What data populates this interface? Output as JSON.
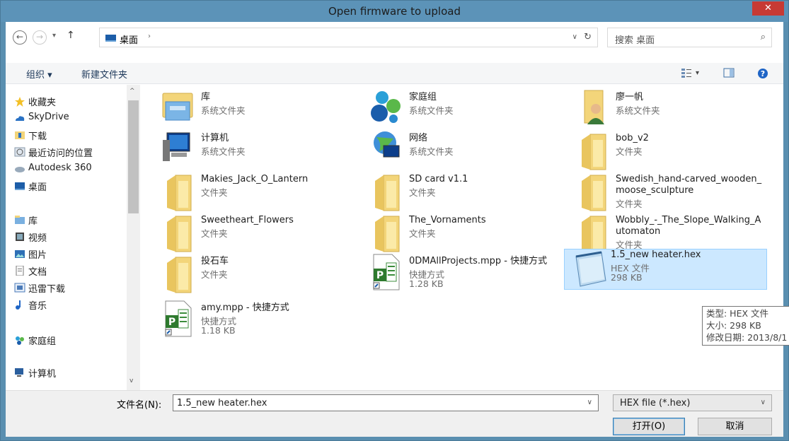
{
  "window": {
    "title": "Open firmware to upload",
    "close_glyph": "✕"
  },
  "nav": {
    "back_glyph": "←",
    "forward_glyph": "→",
    "recent_glyph": "▾",
    "up_glyph": "↑",
    "address_crumb": "桌面",
    "crumb_arrow": "›",
    "address_dropdown": "∨",
    "refresh_glyph": "↻",
    "search_placeholder": "搜索 桌面",
    "search_glyph": "⌕"
  },
  "toolbar": {
    "organize": "组织 ▾",
    "new_folder": "新建文件夹",
    "view_dropdown": "▾",
    "help_glyph": "?"
  },
  "sidebar": {
    "items": [
      {
        "label": "收藏夹",
        "icon": "star-icon",
        "top": 0
      },
      {
        "label": "SkyDrive",
        "icon": "cloud-icon"
      },
      {
        "label": "下载",
        "icon": "download-folder-icon"
      },
      {
        "label": "最近访问的位置",
        "icon": "recent-places-icon"
      },
      {
        "label": "Autodesk 360",
        "icon": "autodesk-icon"
      },
      {
        "label": "桌面",
        "icon": "desktop-icon"
      },
      {
        "label": "库",
        "icon": "library-icon"
      },
      {
        "label": "视频",
        "icon": "video-icon"
      },
      {
        "label": "图片",
        "icon": "picture-icon"
      },
      {
        "label": "文档",
        "icon": "document-icon"
      },
      {
        "label": "迅雷下载",
        "icon": "thunder-icon"
      },
      {
        "label": "音乐",
        "icon": "music-icon"
      },
      {
        "label": "家庭组",
        "icon": "homegroup-icon"
      },
      {
        "label": "计算机",
        "icon": "computer-icon"
      }
    ],
    "scroll_up": "^",
    "scroll_down": "v"
  },
  "files": [
    {
      "name": "库",
      "sub1": "系统文件夹",
      "icon": "library-icon"
    },
    {
      "name": "家庭组",
      "sub1": "系统文件夹",
      "icon": "homegroup-icon"
    },
    {
      "name": "廖一帆",
      "sub1": "系统文件夹",
      "icon": "user-folder-icon"
    },
    {
      "name": "计算机",
      "sub1": "系统文件夹",
      "icon": "computer-icon"
    },
    {
      "name": "网络",
      "sub1": "系统文件夹",
      "icon": "network-icon"
    },
    {
      "name": "bob_v2",
      "sub1": "文件夹",
      "icon": "folder-icon"
    },
    {
      "name": "Makies_Jack_O_Lantern",
      "sub1": "文件夹",
      "icon": "folder-icon"
    },
    {
      "name": "SD card v1.1",
      "sub1": "文件夹",
      "icon": "folder-icon"
    },
    {
      "name": "Swedish_hand-carved_wooden_\nmoose_sculpture",
      "sub1": "文件夹",
      "icon": "folder-icon"
    },
    {
      "name": "Sweetheart_Flowers",
      "sub1": "文件夹",
      "icon": "folder-icon"
    },
    {
      "name": "The_Vornaments",
      "sub1": "文件夹",
      "icon": "folder-icon"
    },
    {
      "name": "Wobbly_-_The_Slope_Walking_A\nutomaton",
      "sub1": "文件夹",
      "icon": "folder-icon"
    },
    {
      "name": "投石车",
      "sub1": "文件夹",
      "icon": "folder-icon"
    },
    {
      "name": "0DMAllProjects.mpp - 快捷方式",
      "sub1": "快捷方式",
      "sub2": "1.28 KB",
      "icon": "project-shortcut-icon"
    },
    {
      "name": "1.5_new heater.hex",
      "sub1": "HEX 文件",
      "sub2": "298 KB",
      "icon": "notepad-icon"
    },
    {
      "name": "amy.mpp - 快捷方式",
      "sub1": "快捷方式",
      "sub2": "1.18 KB",
      "icon": "project-shortcut-icon"
    }
  ],
  "tooltip": {
    "line1": "类型: HEX 文件",
    "line2": "大小: 298 KB",
    "line3": "修改日期: 2013/8/1"
  },
  "bottom": {
    "filename_label": "文件名(N):",
    "filename_value": "1.5_new heater.hex",
    "filename_dropdown": "∨",
    "filter_value": "HEX file (*.hex)",
    "filter_dropdown": "∨",
    "open_label": "打开(O)",
    "cancel_label": "取消"
  },
  "colors": {
    "titlebar": "#5c93b8",
    "close": "#c73a34",
    "selection": "#cce8ff",
    "folder": "#f3d57a"
  }
}
